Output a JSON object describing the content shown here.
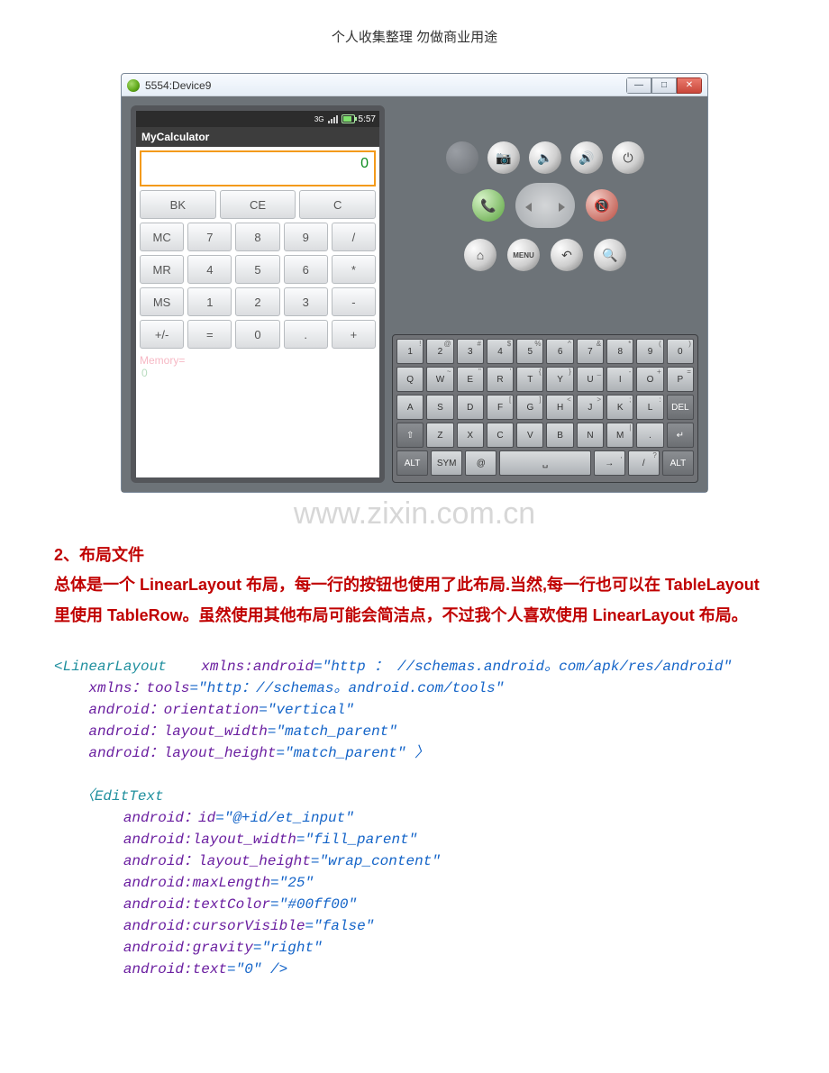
{
  "header": "个人收集整理  勿做商业用途",
  "emulator": {
    "title": "5554:Device9",
    "statusbar": {
      "time": "5:57",
      "network_icon": "3g-icon"
    },
    "app_title": "MyCalculator",
    "display_value": "0",
    "rows": [
      [
        "BK",
        "CE",
        "C"
      ],
      [
        "MC",
        "7",
        "8",
        "9",
        "/"
      ],
      [
        "MR",
        "4",
        "5",
        "6",
        "*"
      ],
      [
        "MS",
        "1",
        "2",
        "3",
        "-"
      ],
      [
        "+/-",
        "=",
        "0",
        ".",
        "+"
      ]
    ],
    "memory_label": "Memory=",
    "memory_value": "0",
    "hw_buttons": {
      "call_icon": "📞",
      "end_icon": "📵",
      "camera": "📷",
      "vol_down": "🔈",
      "vol_up": "🔊",
      "power": "⏻",
      "home": "⌂",
      "menu": "MENU",
      "back": "↶",
      "search": "🔍"
    },
    "keyboard": {
      "row1": [
        {
          "m": "1",
          "s": "!"
        },
        {
          "m": "2",
          "s": "@"
        },
        {
          "m": "3",
          "s": "#"
        },
        {
          "m": "4",
          "s": "$"
        },
        {
          "m": "5",
          "s": "%"
        },
        {
          "m": "6",
          "s": "^"
        },
        {
          "m": "7",
          "s": "&"
        },
        {
          "m": "8",
          "s": "*"
        },
        {
          "m": "9",
          "s": "("
        },
        {
          "m": "0",
          "s": ")"
        }
      ],
      "row2": [
        {
          "m": "Q"
        },
        {
          "m": "W",
          "s": "~"
        },
        {
          "m": "E",
          "s": "\""
        },
        {
          "m": "R",
          "s": "'"
        },
        {
          "m": "T",
          "s": "{"
        },
        {
          "m": "Y",
          "s": "}"
        },
        {
          "m": "U",
          "s": "_"
        },
        {
          "m": "I",
          "s": "-"
        },
        {
          "m": "O",
          "s": "+"
        },
        {
          "m": "P",
          "s": "="
        }
      ],
      "row3": [
        {
          "m": "A"
        },
        {
          "m": "S"
        },
        {
          "m": "D"
        },
        {
          "m": "F",
          "s": "["
        },
        {
          "m": "G",
          "s": "]"
        },
        {
          "m": "H",
          "s": "<"
        },
        {
          "m": "J",
          "s": ">"
        },
        {
          "m": "K",
          "s": ";"
        },
        {
          "m": "L",
          "s": ":"
        },
        {
          "m": "DEL",
          "dark": true
        }
      ],
      "row4": [
        {
          "m": "⇧",
          "dark": true
        },
        {
          "m": "Z"
        },
        {
          "m": "X"
        },
        {
          "m": "C"
        },
        {
          "m": "V"
        },
        {
          "m": "B"
        },
        {
          "m": "N"
        },
        {
          "m": "M",
          "s": "|"
        },
        {
          "m": "."
        },
        {
          "m": "↵",
          "dark": true
        }
      ],
      "row5": [
        {
          "m": "ALT",
          "dark": true
        },
        {
          "m": "SYM"
        },
        {
          "m": "@"
        },
        {
          "m": "␣",
          "wide": true
        },
        {
          "m": "→",
          "s": ","
        },
        {
          "m": "/",
          "s": "?"
        },
        {
          "m": "ALT",
          "dark": true
        }
      ]
    }
  },
  "watermark": "www.zixin.com.cn",
  "section_title_num": "2、",
  "section_title": "布局文件",
  "section_body": "总体是一个 LinearLayout 布局，每一行的按钮也使用了此布局.当然,每一行也可以在 TableLayout 里使用 TableRow。虽然使用其他布局可能会简洁点，不过我个人喜欢使用 LinearLayout 布局。",
  "code": {
    "ll_tag": "<LinearLayout",
    "ll_attr1": "xmlns:android",
    "ll_val1": "=\"http ： //schemas.android。com/apk/res/android\"",
    "ll_attr2": "xmlns：tools",
    "ll_val2": "=\"http：//schemas。android.com/tools\"",
    "ll_attr3": "android：orientation",
    "ll_val3": "=\"vertical\"",
    "ll_attr4": "android：layout_width",
    "ll_val4": "=\"match_parent\"",
    "ll_attr5": "android：layout_height",
    "ll_val5": "=\"match_parent\" 〉",
    "et_tag": "〈EditText",
    "et_a1": "android：id",
    "et_v1": "=\"@+id/et_input\"",
    "et_a2": "android:layout_width",
    "et_v2": "=\"fill_parent\"",
    "et_a3": "android：layout_height",
    "et_v3": "=\"wrap_content\"",
    "et_a4": "android:maxLength",
    "et_v4": "=\"25\"",
    "et_a5": "android:textColor",
    "et_v5": "=\"#00ff00\"",
    "et_a6": "android:cursorVisible",
    "et_v6": "=\"false\"",
    "et_a7": "android:gravity",
    "et_v7": "=\"right\"",
    "et_a8": "android:text",
    "et_v8": "=\"0\" />"
  }
}
